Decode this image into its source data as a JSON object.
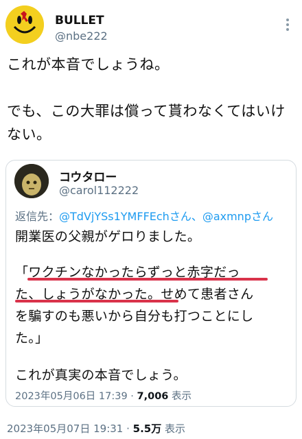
{
  "author": {
    "name": "BULLET",
    "handle": "@nbe222"
  },
  "tweet": {
    "lines": [
      "これが本音でしょうね。",
      "でも、この大罪は償って貰わなくてはいけ",
      "ない。"
    ]
  },
  "quote": {
    "name": "コウタロー",
    "handle": "@carol112222",
    "reply_prefix": "返信先：",
    "reply_mentions": "@TdVjYSs1YMFFEchさん、@axmnpさん",
    "lines": [
      "開業医の父親がゲロりました。",
      "「ワクチンなかったらずっと赤字だっ",
      "た、しょうがなかった。せめて患者さん",
      "を騙すのも悪いから自分も打つことにし",
      "た。」",
      "これが真実の本音でしょう。"
    ],
    "meta": {
      "datetime": "2023年05月06日 17:39",
      "sep": " · ",
      "views": "7,006",
      "views_label": " 表示"
    }
  },
  "meta": {
    "datetime": "2023年05月07日 19:31",
    "sep": " · ",
    "views": "5.5万",
    "views_label": " 表示"
  },
  "icons": {
    "more": "more-options-icon",
    "avatar_main": "smiley-badge-avatar",
    "avatar_quote": "figure-avatar"
  },
  "colors": {
    "mention": "#1d9bf0",
    "underline": "#d9324a",
    "secondary": "#5b7083"
  }
}
